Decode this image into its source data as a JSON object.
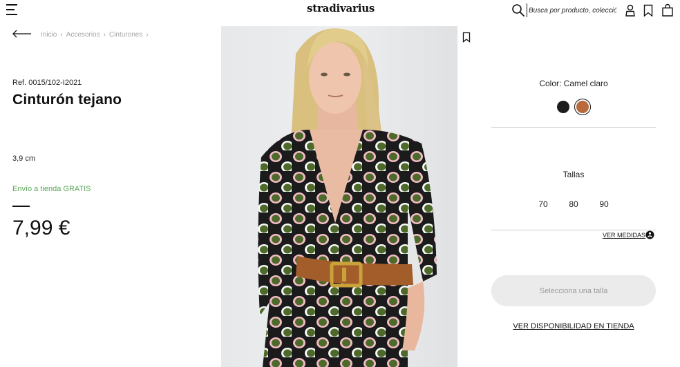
{
  "header": {
    "logo_text": "stradivarius",
    "search": {
      "placeholder": "Busca por producto, colección..."
    }
  },
  "breadcrumb": {
    "items": [
      "Inicio",
      "Accesorios",
      "Cinturones"
    ],
    "separator": "›"
  },
  "product": {
    "reference": "Ref. 0015/102-I2021",
    "title": "Cinturón tejano",
    "width": "3,9 cm",
    "shipping": "Envío a tienda GRATIS",
    "price": "7,99 €"
  },
  "color_selector": {
    "label": "Color: Camel claro",
    "swatches": [
      {
        "name": "Negro",
        "hex": "#1c1c1c",
        "selected": false
      },
      {
        "name": "Camel claro",
        "hex": "#b86a3a",
        "selected": true
      }
    ]
  },
  "sizes": {
    "label": "Tallas",
    "options": [
      "70",
      "80",
      "90"
    ],
    "guide_link": "VER MEDIDAS"
  },
  "actions": {
    "select_size": "Selecciona una talla",
    "store_availability": "VER DISPONIBILIDAD EN TIENDA"
  },
  "colors": {
    "shipping_green": "#5aa65a",
    "button_bg": "#ebebeb",
    "button_text": "#9a9a9a",
    "breadcrumb_gray": "#a5a5a5"
  }
}
